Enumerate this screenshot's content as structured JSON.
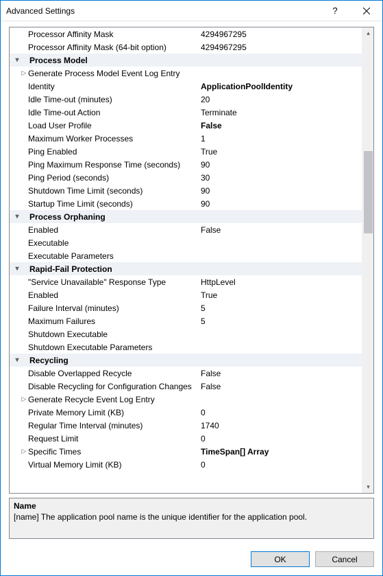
{
  "window": {
    "title": "Advanced Settings",
    "help_tooltip": "?",
    "close_tooltip": "Close"
  },
  "rows": [
    {
      "type": "prop",
      "expand": "",
      "label": "Processor Affinity Mask",
      "value": "4294967295",
      "bold": false
    },
    {
      "type": "prop",
      "expand": "",
      "label": "Processor Affinity Mask (64-bit option)",
      "value": "4294967295",
      "bold": false
    },
    {
      "type": "cat",
      "toggle": "v",
      "label": "Process Model"
    },
    {
      "type": "prop",
      "expand": ">",
      "label": "Generate Process Model Event Log Entry",
      "value": "",
      "bold": false
    },
    {
      "type": "prop",
      "expand": "",
      "label": "Identity",
      "value": "ApplicationPoolIdentity",
      "bold": true
    },
    {
      "type": "prop",
      "expand": "",
      "label": "Idle Time-out (minutes)",
      "value": "20",
      "bold": false
    },
    {
      "type": "prop",
      "expand": "",
      "label": "Idle Time-out Action",
      "value": "Terminate",
      "bold": false
    },
    {
      "type": "prop",
      "expand": "",
      "label": "Load User Profile",
      "value": "False",
      "bold": true
    },
    {
      "type": "prop",
      "expand": "",
      "label": "Maximum Worker Processes",
      "value": "1",
      "bold": false
    },
    {
      "type": "prop",
      "expand": "",
      "label": "Ping Enabled",
      "value": "True",
      "bold": false
    },
    {
      "type": "prop",
      "expand": "",
      "label": "Ping Maximum Response Time (seconds)",
      "value": "90",
      "bold": false
    },
    {
      "type": "prop",
      "expand": "",
      "label": "Ping Period (seconds)",
      "value": "30",
      "bold": false
    },
    {
      "type": "prop",
      "expand": "",
      "label": "Shutdown Time Limit (seconds)",
      "value": "90",
      "bold": false
    },
    {
      "type": "prop",
      "expand": "",
      "label": "Startup Time Limit (seconds)",
      "value": "90",
      "bold": false
    },
    {
      "type": "cat",
      "toggle": "v",
      "label": "Process Orphaning"
    },
    {
      "type": "prop",
      "expand": "",
      "label": "Enabled",
      "value": "False",
      "bold": false
    },
    {
      "type": "prop",
      "expand": "",
      "label": "Executable",
      "value": "",
      "bold": false
    },
    {
      "type": "prop",
      "expand": "",
      "label": "Executable Parameters",
      "value": "",
      "bold": false
    },
    {
      "type": "cat",
      "toggle": "v",
      "label": "Rapid-Fail Protection"
    },
    {
      "type": "prop",
      "expand": "",
      "label": "\"Service Unavailable\" Response Type",
      "value": "HttpLevel",
      "bold": false
    },
    {
      "type": "prop",
      "expand": "",
      "label": "Enabled",
      "value": "True",
      "bold": false
    },
    {
      "type": "prop",
      "expand": "",
      "label": "Failure Interval (minutes)",
      "value": "5",
      "bold": false
    },
    {
      "type": "prop",
      "expand": "",
      "label": "Maximum Failures",
      "value": "5",
      "bold": false
    },
    {
      "type": "prop",
      "expand": "",
      "label": "Shutdown Executable",
      "value": "",
      "bold": false
    },
    {
      "type": "prop",
      "expand": "",
      "label": "Shutdown Executable Parameters",
      "value": "",
      "bold": false
    },
    {
      "type": "cat",
      "toggle": "v",
      "label": "Recycling"
    },
    {
      "type": "prop",
      "expand": "",
      "label": "Disable Overlapped Recycle",
      "value": "False",
      "bold": false
    },
    {
      "type": "prop",
      "expand": "",
      "label": "Disable Recycling for Configuration Changes",
      "value": "False",
      "bold": false
    },
    {
      "type": "prop",
      "expand": ">",
      "label": "Generate Recycle Event Log Entry",
      "value": "",
      "bold": false
    },
    {
      "type": "prop",
      "expand": "",
      "label": "Private Memory Limit (KB)",
      "value": "0",
      "bold": false
    },
    {
      "type": "prop",
      "expand": "",
      "label": "Regular Time Interval (minutes)",
      "value": "1740",
      "bold": false
    },
    {
      "type": "prop",
      "expand": "",
      "label": "Request Limit",
      "value": "0",
      "bold": false
    },
    {
      "type": "prop",
      "expand": ">",
      "label": "Specific Times",
      "value": "TimeSpan[] Array",
      "bold": true
    },
    {
      "type": "prop",
      "expand": "",
      "label": "Virtual Memory Limit (KB)",
      "value": "0",
      "bold": false
    }
  ],
  "description": {
    "title": "Name",
    "text": "[name] The application pool name is the unique identifier for the application pool."
  },
  "buttons": {
    "ok": "OK",
    "cancel": "Cancel"
  }
}
